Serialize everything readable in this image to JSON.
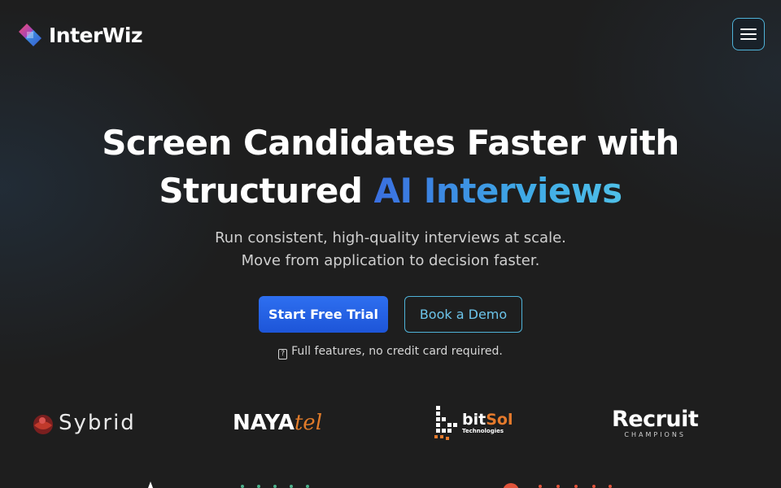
{
  "brand": {
    "name": "InterWiz"
  },
  "menu": {
    "icon": "hamburger-menu-icon"
  },
  "hero": {
    "title_line1": "Screen Candidates Faster with",
    "title_line2_plain": "Structured ",
    "title_line2_accent": "AI Interviews",
    "subtitle_line1": "Run consistent, high-quality interviews at scale.",
    "subtitle_line2": "Move from application to decision faster."
  },
  "cta": {
    "primary_label": "Start Free Trial",
    "secondary_label": "Book a Demo",
    "note_icon": "?",
    "note": "Full features, no credit card required."
  },
  "partners": {
    "sybrid": "Sybrid",
    "nayatel_naya": "NAYA",
    "nayatel_tel": "tel",
    "bitsol_bit": "bit",
    "bitsol_sol": "Sol",
    "bitsol_sub": "Technologies",
    "recruit_name": "Recruit",
    "recruit_sub": "CHAMPIONS"
  },
  "colors": {
    "background": "#1e1e1e",
    "accent_blue": "#2e6ff0",
    "accent_cyan": "#4fb3d9",
    "orange": "#e07b2a"
  }
}
